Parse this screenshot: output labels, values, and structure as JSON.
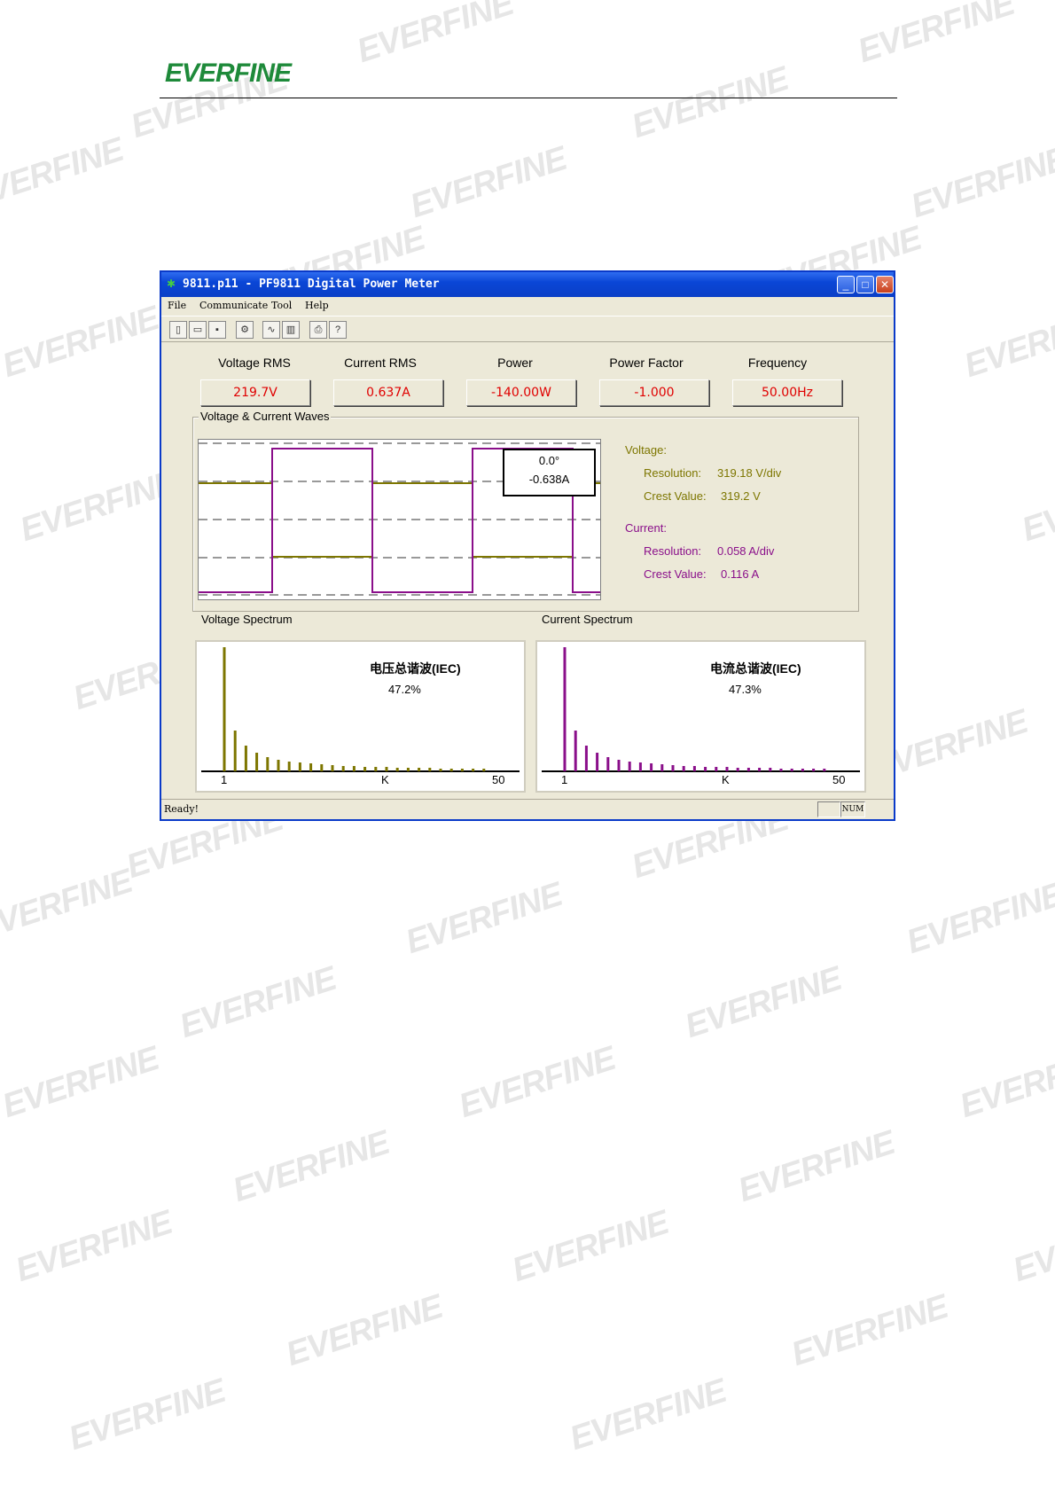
{
  "brand": {
    "logo": "EVERFINE"
  },
  "watermark": "EVERFINE",
  "window": {
    "title": "9811.p11 - PF9811 Digital Power Meter",
    "menu": [
      "File",
      "Communicate",
      "Tool",
      "Help"
    ],
    "toolbar_icons": [
      "new-icon",
      "open-icon",
      "save-icon",
      "connect-icon",
      "wave-icon",
      "chart-icon",
      "print-icon",
      "help-icon"
    ]
  },
  "measurements": [
    {
      "label": "Voltage RMS",
      "value": "219.7V"
    },
    {
      "label": "Current RMS",
      "value": "0.637A"
    },
    {
      "label": "Power",
      "value": "-140.00W"
    },
    {
      "label": "Power Factor",
      "value": "-1.000"
    },
    {
      "label": "Frequency",
      "value": "50.00Hz"
    }
  ],
  "waves": {
    "title": "Voltage & Current Waves",
    "cursor": {
      "angle": "0.0°",
      "current": "-0.638A"
    },
    "voltage": {
      "heading": "Voltage:",
      "resolution_label": "Resolution:",
      "resolution": "319.18  V/div",
      "crest_label": "Crest Value:",
      "crest": "319.2  V"
    },
    "current": {
      "heading": "Current:",
      "resolution_label": "Resolution:",
      "resolution": "0.058  A/div",
      "crest_label": "Crest Value:",
      "crest": "0.116  A"
    }
  },
  "voltage_spectrum": {
    "title": "Voltage Spectrum",
    "thd_label": "电压总谐波(IEC)",
    "thd_value": "47.2%",
    "x_start": "1",
    "x_mid": "K",
    "x_end": "50"
  },
  "current_spectrum": {
    "title": "Current Spectrum",
    "thd_label": "电流总谐波(IEC)",
    "thd_value": "47.3%",
    "x_start": "1",
    "x_mid": "K",
    "x_end": "50"
  },
  "status": {
    "text": "Ready!",
    "num": "NUM"
  },
  "colors": {
    "voltage": "#7d7600",
    "current": "#8a0f8a",
    "value_red": "#e00000",
    "titlebar": "#0a46d6"
  }
}
